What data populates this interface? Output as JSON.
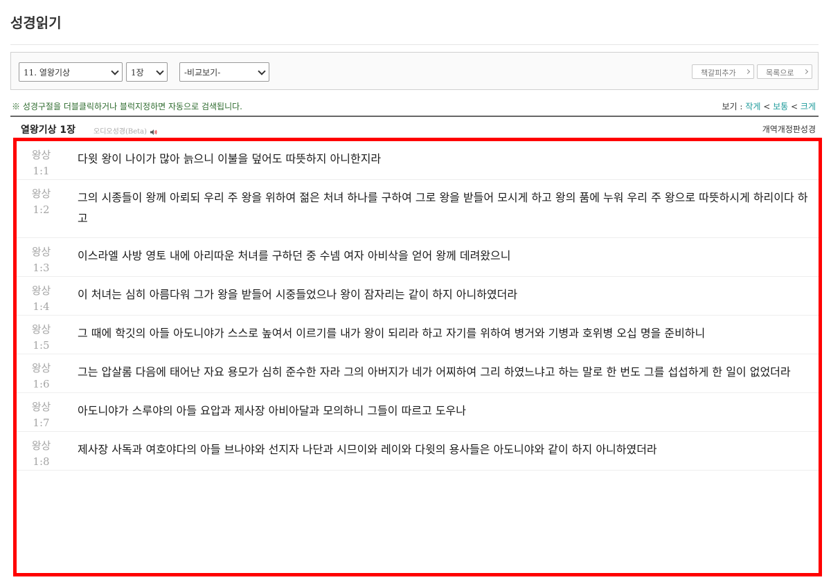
{
  "page": {
    "title": "성경읽기"
  },
  "toolbar": {
    "book_select": "11. 열왕기상",
    "chapter_select": "1장",
    "compare_select": "-비교보기-",
    "bookmark_button": "책갈피추가",
    "list_button": "목록으로"
  },
  "notice": "※ 성경구절을 더블클릭하거나 블럭지정하면 자동으로 검색됩니다.",
  "view_size": {
    "label": "보기 :",
    "small": "작게",
    "sep1": "<",
    "normal": "보통",
    "sep2": "<",
    "large": "크게"
  },
  "chapter": {
    "title": "열왕기상 1장",
    "audio_label": "오디오성경(Beta)",
    "version": "개역개정판성경"
  },
  "verses": [
    {
      "book": "왕상",
      "num": "1:1",
      "text": "다윗 왕이 나이가 많아 늙으니 이불을 덮어도 따뜻하지 아니한지라"
    },
    {
      "book": "왕상",
      "num": "1:2",
      "text": "그의 시종들이 왕께 아뢰되 우리 주 왕을 위하여 젊은 처녀 하나를 구하여 그로 왕을 받들어 모시게 하고 왕의 품에 누워 우리 주 왕으로 따뜻하시게 하리이다 하고"
    },
    {
      "book": "왕상",
      "num": "1:3",
      "text": "이스라엘 사방 영토 내에 아리따운 처녀를 구하던 중 수넴 여자 아비삭을 얻어 왕께 데려왔으니"
    },
    {
      "book": "왕상",
      "num": "1:4",
      "text": "이 처녀는 심히 아름다워 그가 왕을 받들어 시중들었으나 왕이 잠자리는 같이 하지 아니하였더라"
    },
    {
      "book": "왕상",
      "num": "1:5",
      "text": "그 때에 학깃의 아들 아도니야가 스스로 높여서 이르기를 내가 왕이 되리라 하고 자기를 위하여 병거와 기병과 호위병 오십 명을 준비하니"
    },
    {
      "book": "왕상",
      "num": "1:6",
      "text": "그는 압살롬 다음에 태어난 자요 용모가 심히 준수한 자라 그의 아버지가 네가 어찌하여 그리 하였느냐고 하는 말로 한 번도 그를 섭섭하게 한 일이 없었더라"
    },
    {
      "book": "왕상",
      "num": "1:7",
      "text": "아도니야가 스루야의 아들 요압과 제사장 아비아달과 모의하니 그들이 따르고 도우나"
    },
    {
      "book": "왕상",
      "num": "1:8",
      "text": "제사장 사독과 여호야다의 아들 브나야와 선지자 나단과 시므이와 레이와 다윗의 용사들은 아도니야와 같이 하지 아니하였더라"
    }
  ]
}
